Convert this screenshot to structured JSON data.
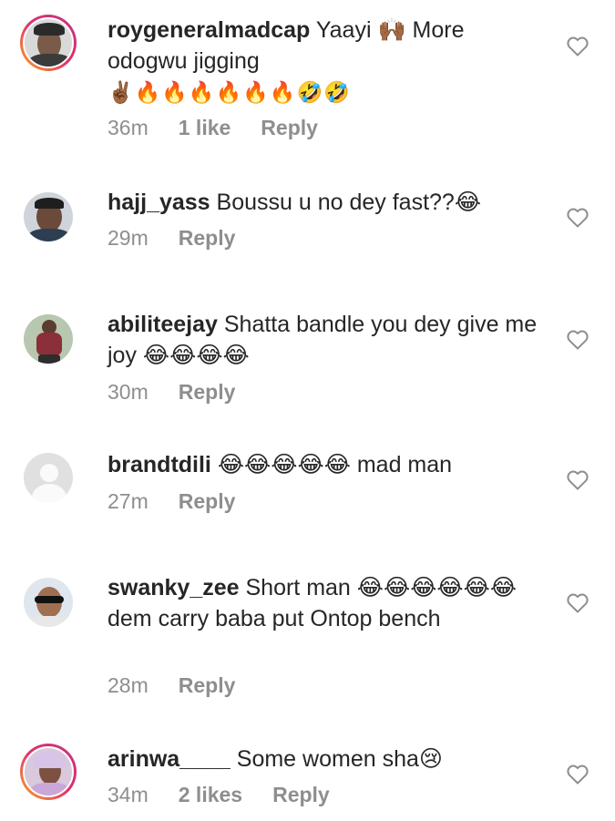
{
  "comments": [
    {
      "username": "roygeneralmadcap",
      "text": "Yaayi 🙌🏾 More odogwu jigging",
      "text_line2_emoji": "✌🏾🔥🔥🔥🔥🔥🔥🤣🤣",
      "time": "36m",
      "likes": "1 like",
      "reply": "Reply",
      "story_ring": true
    },
    {
      "username": "hajj_yass",
      "text": "Boussu u no dey fast??😂",
      "time": "29m",
      "reply": "Reply",
      "story_ring": false
    },
    {
      "username": "abiliteejay",
      "text": "Shatta bandle you dey give me joy 😂😂😂😂",
      "time": "30m",
      "reply": "Reply",
      "story_ring": false
    },
    {
      "username": "brandtdili",
      "text": "😂😂😂😂😂 mad man",
      "time": "27m",
      "reply": "Reply",
      "story_ring": false
    },
    {
      "username": "swanky_zee",
      "text": "Short man 😂😂😂😂😂😂 dem carry baba put Ontop bench",
      "time": "28m",
      "reply": "Reply",
      "story_ring": false
    },
    {
      "username": "arinwa____",
      "text": "Some women sha😢",
      "time": "34m",
      "likes": "2 likes",
      "reply": "Reply",
      "story_ring": true
    }
  ],
  "icons": {
    "heart": "heart-outline-icon"
  },
  "colors": {
    "meta": "#8e8e8e",
    "text": "#262626",
    "story_ring_start": "#f9a825",
    "story_ring_end": "#c13584"
  }
}
